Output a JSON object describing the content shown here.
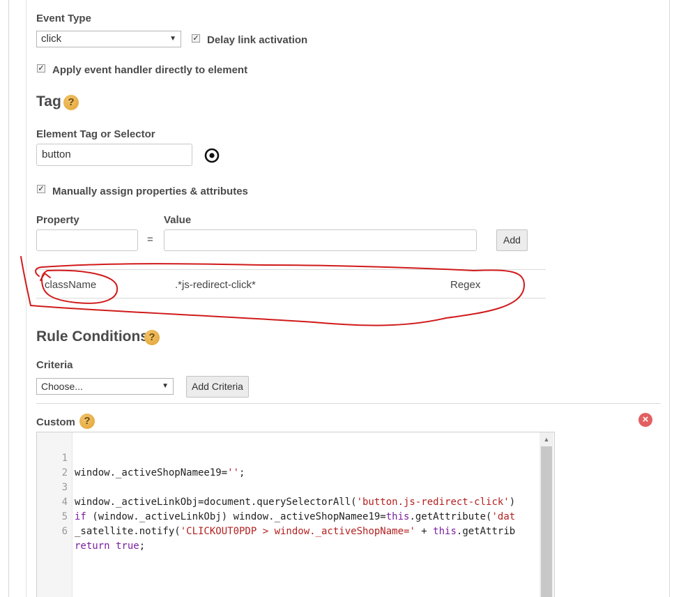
{
  "event_type": {
    "label": "Event Type",
    "selected": "click",
    "delay_link_activation": {
      "label": "Delay link activation",
      "checked": true
    },
    "apply_handler_directly": {
      "label": "Apply event handler directly to element",
      "checked": true
    }
  },
  "tag": {
    "title": "Tag",
    "help": "?",
    "selector_label": "Element Tag or Selector",
    "selector_value": "button",
    "manual_assign": {
      "label": "Manually assign properties & attributes",
      "checked": true
    }
  },
  "properties": {
    "property_label": "Property",
    "value_label": "Value",
    "equals": "=",
    "add_label": "Add",
    "property_value": "",
    "value_value": "",
    "rows": [
      {
        "property": "className",
        "value": ".*js-redirect-click*",
        "type": "Regex"
      }
    ]
  },
  "rule_conditions": {
    "title": "Rule Conditions",
    "help": "?",
    "criteria_label": "Criteria",
    "criteria_selected": "Choose...",
    "add_criteria_label": "Add Criteria"
  },
  "custom": {
    "label": "Custom",
    "help": "?",
    "remove_icon": "close-icon",
    "lines": [
      {
        "num": "1",
        "code": "window._activeShopNamee19='';"
      },
      {
        "num": "2",
        "code": ""
      },
      {
        "num": "3",
        "code": "window._activeLinkObj=document.querySelectorAll('button.js-redirect-click')"
      },
      {
        "num": "4",
        "code": "if (window._activeLinkObj) window._activeShopNamee19=this.getAttribute('dat"
      },
      {
        "num": "5",
        "code": "_satellite.notify('CLICKOUT0PDP > window._activeShopName=' + this.getAttrib"
      },
      {
        "num": "6",
        "code": "return true;"
      }
    ]
  },
  "colors": {
    "annotation": "#d11a1a",
    "help_icon": "#e2a232",
    "remove_icon": "#e26060"
  }
}
